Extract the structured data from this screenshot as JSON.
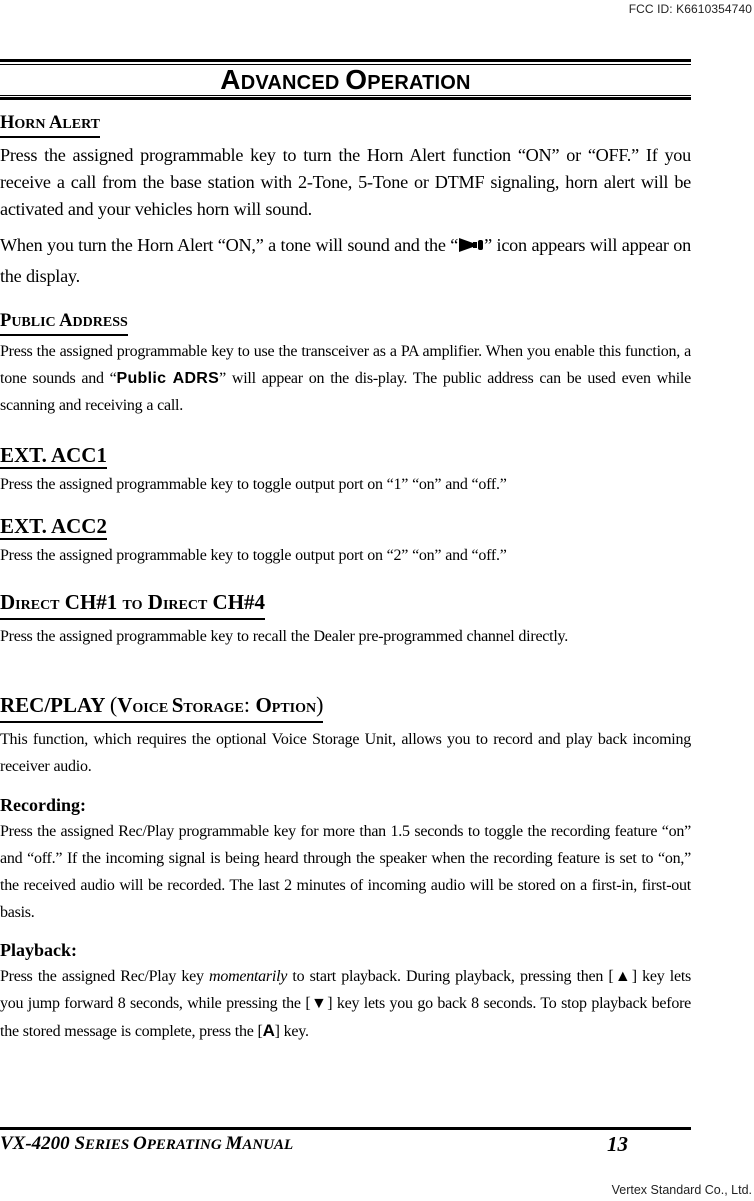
{
  "fcc_id": "FCC ID: K6610354740",
  "vendor": "Vertex Standard Co., Ltd.",
  "chapter": {
    "title_cap1": "A",
    "title_rest1": "DVANCED ",
    "title_cap2": "O",
    "title_rest2": "PERATION"
  },
  "sections": {
    "horn_alert": {
      "title_cap1": "H",
      "title_rest1": "ORN ",
      "title_cap2": "A",
      "title_rest2": "LERT",
      "para1": "Press the assigned programmable key to turn the Horn Alert function “ON” or “OFF.” If you receive a call from the base station with 2-Tone, 5-Tone or DTMF signaling, horn alert will be activated and your vehicles horn will sound.",
      "para2_before": "When you turn the Horn Alert “ON,” a tone will sound and the “",
      "para2_icon": "horn-icon",
      "para2_after": "” icon appears will appear on the display."
    },
    "public_address": {
      "title_cap1": "P",
      "title_rest1": "UBLIC ",
      "title_cap2": "A",
      "title_rest2": "DDRESS",
      "para_before": "Press the assigned programmable key to use the transceiver as a PA amplifier. When you enable this function, a tone sounds and “",
      "lcd_text": "Public ADRS",
      "para_after": "” will appear on the dis-play. The public address can be used even while scanning and receiving a call."
    },
    "ext_acc1": {
      "title": "EXT. ACC1",
      "para": "Press the assigned programmable key to toggle output port on “1” “on” and “off.”"
    },
    "ext_acc2": {
      "title": "EXT. ACC2",
      "para": "Press the assigned programmable key to toggle output port on “2” “on” and “off.”"
    },
    "direct_ch": {
      "t1_cap": "D",
      "t1_rest": "IRECT",
      "t2": " CH#1 ",
      "t3_sc": "TO",
      "t4_cap": " D",
      "t4_rest": "IRECT",
      "t5": " CH#4",
      "para": "Press the assigned programmable key to recall the Dealer pre-programmed channel directly."
    },
    "rec_play": {
      "t1": "REC/PLAY ",
      "t_open": "(",
      "t2_cap": "V",
      "t2_rest": "OICE ",
      "t3_cap": "S",
      "t3_rest": "TORAGE",
      "t_colon": ": ",
      "t4_cap": "O",
      "t4_rest": "PTION",
      "t_close": ")",
      "para": "This function, which requires the optional Voice Storage Unit, allows you to record and play back incoming receiver audio.",
      "recording": {
        "label": "Recording:",
        "para": "Press the assigned Rec/Play programmable key for more than 1.5 seconds to toggle the recording feature “on” and “off.” If the incoming signal is being heard through the speaker when the recording feature is set to “on,” the received audio will be recorded. The last 2 minutes of incoming audio will be stored on a first-in, first-out basis."
      },
      "playback": {
        "label": "Playback:",
        "p1": "Press the assigned Rec/Play key ",
        "p1_italic": "momentarily",
        "p2": " to start playback. During playback, pressing then [",
        "up_key": "▲",
        "p3": "] key lets you jump forward 8 seconds, while pressing the [",
        "down_key": "▼",
        "p4": "] key lets you go back 8 seconds. To stop playback before the stored message is complete, press the [",
        "a_key": "A",
        "p5": "] key."
      }
    }
  },
  "footer": {
    "m1": "VX-4200 ",
    "m2_cap": "S",
    "m2_rest": "ERIES ",
    "m3_cap": "O",
    "m3_rest": "PERATING ",
    "m4_cap": "M",
    "m4_rest": "ANUAL",
    "page_number": "13"
  }
}
